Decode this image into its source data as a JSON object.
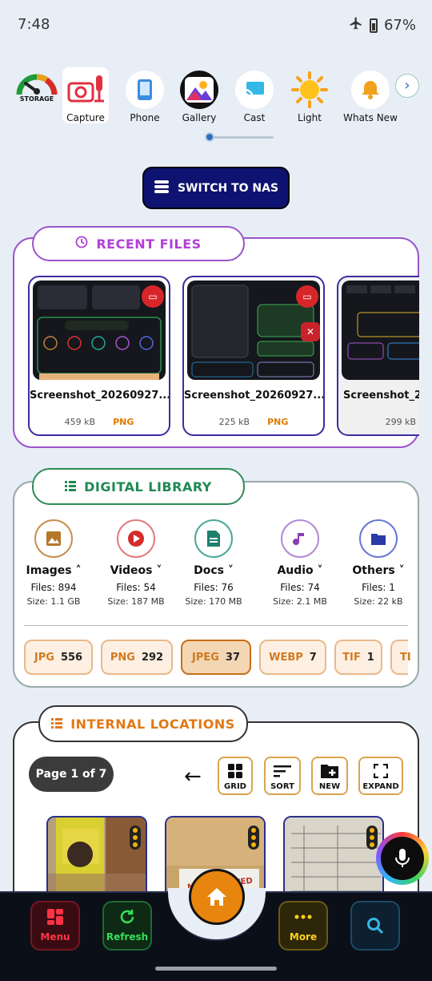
{
  "status": {
    "time": "7:48",
    "battery": "67%",
    "icons": [
      "airplane-icon",
      "battery-icon"
    ]
  },
  "quick": {
    "storage_label": "STORAGE",
    "items": [
      {
        "label": "Capture",
        "icon": "capture-icon"
      },
      {
        "label": "Phone",
        "icon": "phone-icon"
      },
      {
        "label": "Gallery",
        "icon": "gallery-icon"
      },
      {
        "label": "Cast",
        "icon": "cast-icon"
      },
      {
        "label": "Light",
        "icon": "light-icon"
      },
      {
        "label": "Whats New",
        "icon": "bell-icon"
      }
    ]
  },
  "switch_label": "SWITCH TO NAS",
  "recent": {
    "title": "RECENT FILES",
    "files": [
      {
        "name": "Screenshot_20260927...",
        "size": "459 kB",
        "ext": "PNG"
      },
      {
        "name": "Screenshot_20260927...",
        "size": "225 kB",
        "ext": "PNG"
      },
      {
        "name": "Screenshot_20",
        "size": "299 kB",
        "ext": ""
      }
    ]
  },
  "library": {
    "title": "DIGITAL LIBRARY",
    "categories": [
      {
        "name": "Images",
        "files": "Files: 894",
        "size": "Size: 1.1 GB",
        "color": "#b5772a"
      },
      {
        "name": "Videos",
        "files": "Files: 54",
        "size": "Size: 187 MB",
        "color": "#d52b2b"
      },
      {
        "name": "Docs",
        "files": "Files: 76",
        "size": "Size: 170 MB",
        "color": "#1e7f70"
      },
      {
        "name": "Audio",
        "files": "Files: 74",
        "size": "Size: 2.1 MB",
        "color": "#8a3db6"
      },
      {
        "name": "Others",
        "files": "Files: 1",
        "size": "Size: 22 kB",
        "color": "#2b3aa8"
      }
    ],
    "chips": [
      {
        "ext": "JPG",
        "count": "556"
      },
      {
        "ext": "PNG",
        "count": "292"
      },
      {
        "ext": "JPEG",
        "count": "37"
      },
      {
        "ext": "WEBP",
        "count": "7"
      },
      {
        "ext": "TIF",
        "count": "1"
      },
      {
        "ext": "TI",
        "count": ""
      }
    ]
  },
  "internal": {
    "title": "INTERNAL LOCATIONS",
    "page": "Page 1 of 7",
    "tools": [
      "GRID",
      "SORT",
      "NEW",
      "EXPAND"
    ],
    "thumb_texts": [
      "NOT ALLOWED"
    ]
  },
  "nav": {
    "menu": "Menu",
    "refresh": "Refresh",
    "more": "More"
  },
  "colors": {
    "accent_navy": "#0e1270",
    "purple": "#9a55c9",
    "green": "#1e8a50",
    "orange": "#e27816"
  }
}
